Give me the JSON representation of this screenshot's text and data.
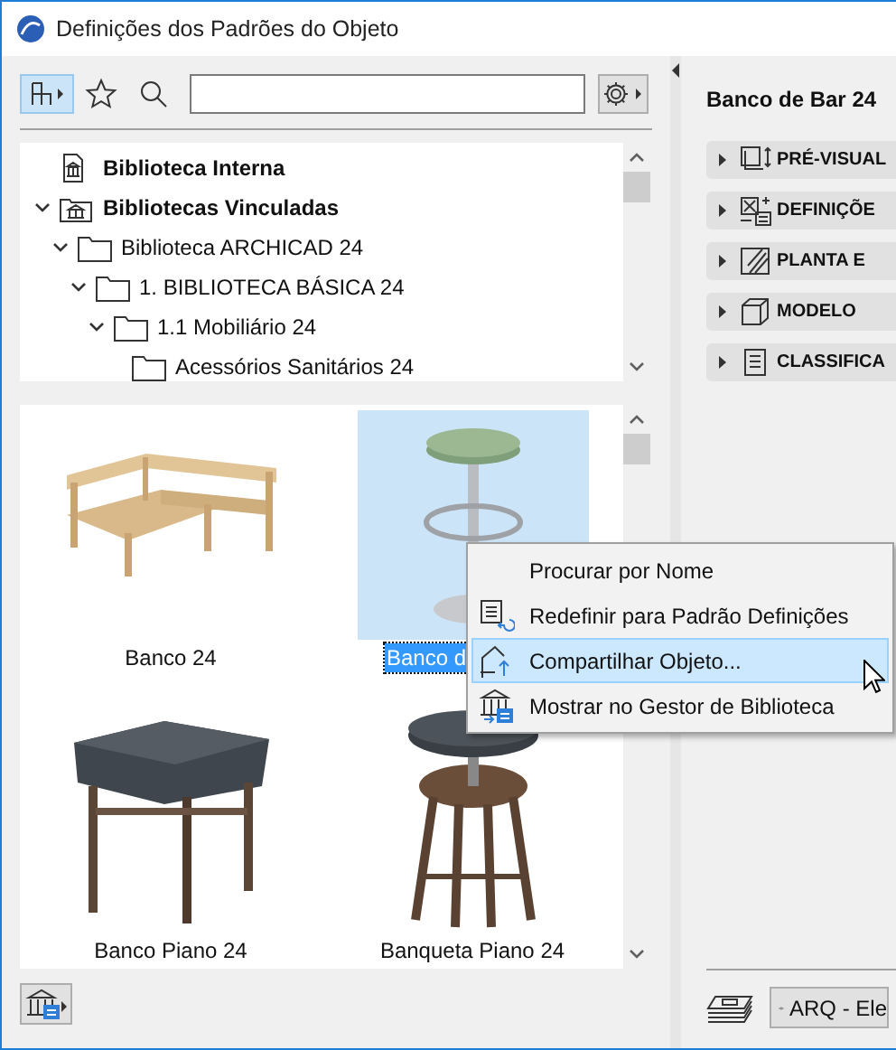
{
  "window": {
    "title": "Definições dos Padrões do Objeto"
  },
  "toolbar": {
    "view_button": {
      "selected": true
    }
  },
  "tree": [
    {
      "label": "Biblioteca Interna",
      "kind": "library-file"
    },
    {
      "label": "Bibliotecas Vinculadas",
      "kind": "library-folder",
      "expanded": true,
      "children": [
        {
          "label": "Biblioteca ARCHICAD 24",
          "kind": "folder",
          "expanded": true,
          "children": [
            {
              "label": "1. BIBLIOTECA BÁSICA 24",
              "kind": "folder",
              "expanded": true,
              "children": [
                {
                  "label": "1.1 Mobiliário 24",
                  "kind": "folder",
                  "expanded": true,
                  "children": [
                    {
                      "label": "Acessórios Sanitários 24",
                      "kind": "folder"
                    }
                  ]
                }
              ]
            }
          ]
        }
      ]
    }
  ],
  "objects": [
    {
      "label": "Banco 24",
      "selected": false
    },
    {
      "label": "Banco d",
      "selected": true
    },
    {
      "label": "Banco Piano 24",
      "selected": false
    },
    {
      "label": "Banqueta Piano 24",
      "selected": false
    }
  ],
  "context_menu": {
    "items": [
      {
        "label": "Procurar por Nome",
        "kind": "none",
        "selected": false
      },
      {
        "label": "Redefinir para Padrão Definições",
        "kind": "reset",
        "selected": false
      },
      {
        "label": "Compartilhar Objeto...",
        "kind": "share",
        "selected": true
      },
      {
        "label": "Mostrar no Gestor de Biblioteca",
        "kind": "library",
        "selected": false
      }
    ]
  },
  "details": {
    "title": "Banco de Bar 24",
    "sections": [
      {
        "label": "PRÉ-VISUAL",
        "kind": "preview",
        "expanded": false
      },
      {
        "label": "DEFINIÇÕE",
        "kind": "settings",
        "expanded": false
      },
      {
        "label": "PLANTA E",
        "kind": "plan",
        "expanded": false
      },
      {
        "label": "MODELO",
        "kind": "model",
        "expanded": false
      },
      {
        "label": "CLASSIFICA",
        "kind": "classification",
        "expanded": false
      }
    ]
  },
  "layer_button": {
    "label": "ARQ - Ele"
  }
}
